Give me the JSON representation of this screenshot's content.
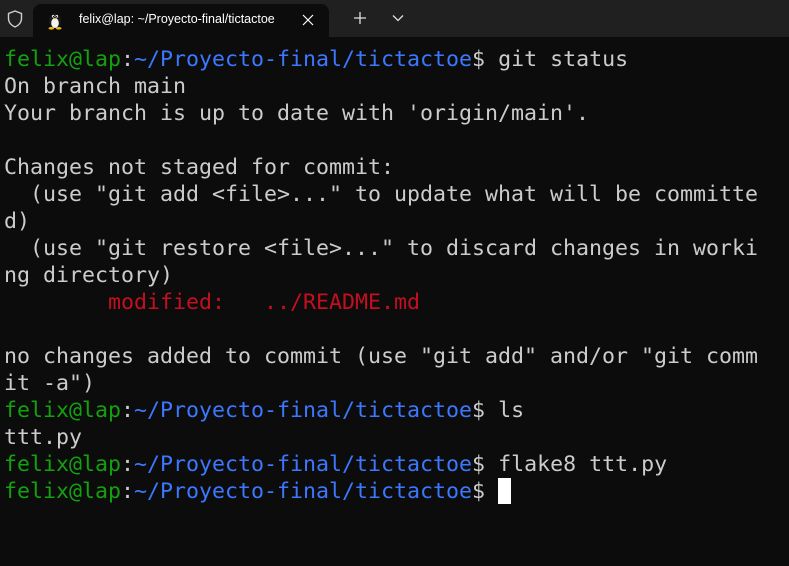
{
  "tab": {
    "title": "felix@lap: ~/Proyecto-final/tictactoe"
  },
  "prompt": {
    "user_host": "felix@lap",
    "sep": ":",
    "path": "~/Proyecto-final/tictactoe",
    "dollar": "$"
  },
  "lines": [
    {
      "type": "prompt",
      "cmd": " git status"
    },
    {
      "type": "out",
      "text": "On branch main"
    },
    {
      "type": "out",
      "text": "Your branch is up to date with 'origin/main'."
    },
    {
      "type": "out",
      "text": ""
    },
    {
      "type": "out",
      "text": "Changes not staged for commit:"
    },
    {
      "type": "out",
      "text": "  (use \"git add <file>...\" to update what will be committe"
    },
    {
      "type": "out",
      "text": "d)"
    },
    {
      "type": "out",
      "text": "  (use \"git restore <file>...\" to discard changes in worki"
    },
    {
      "type": "out",
      "text": "ng directory)"
    },
    {
      "type": "mod",
      "indent": "        ",
      "label": "modified:",
      "gap": "   ",
      "file": "../README.md"
    },
    {
      "type": "out",
      "text": ""
    },
    {
      "type": "out",
      "text": "no changes added to commit (use \"git add\" and/or \"git comm"
    },
    {
      "type": "out",
      "text": "it -a\")"
    },
    {
      "type": "prompt",
      "cmd": " ls"
    },
    {
      "type": "out",
      "text": "ttt.py"
    },
    {
      "type": "prompt",
      "cmd": " flake8 ttt.py"
    },
    {
      "type": "prompt",
      "cmd": " ",
      "cursor": true
    }
  ],
  "icons": {
    "shield": "shield-icon",
    "tux": "linux-tux-icon",
    "close": "close-icon",
    "plus": "plus-icon",
    "chevron": "chevron-down-icon"
  },
  "colors": {
    "green": "#13a10e",
    "blue": "#3b78ff",
    "red": "#c50f1f",
    "text": "#cccccc",
    "bg": "#0c0c0c"
  }
}
